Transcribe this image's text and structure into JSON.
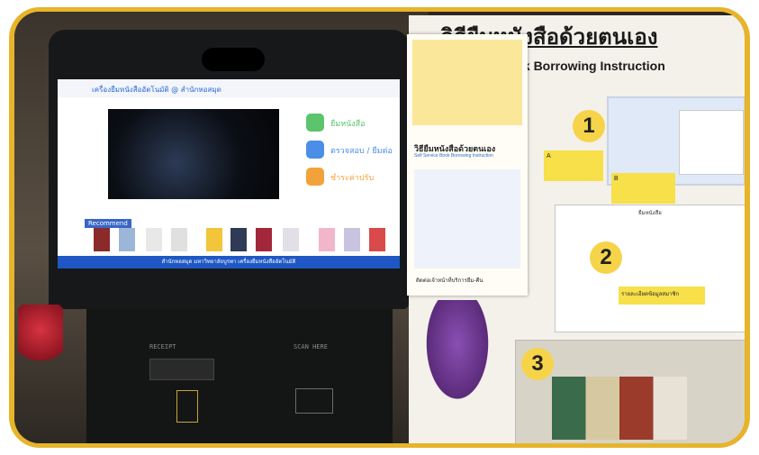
{
  "board": {
    "title": "วิธียืมหนังสือด้วยตนเอง",
    "subtitle": "e Book Borrowing Instruction",
    "steps": [
      "1",
      "2",
      "3"
    ],
    "note_a": "A",
    "note_b": "B",
    "screen2_caption": "รายละเอียดข้อมูลสมาชิก",
    "screen2_title": "ยืมหนังสือ"
  },
  "flyer": {
    "title": "วิธียืมหนังสือด้วยตนเอง",
    "subtitle": "Self Service Book Borrowing Instruction",
    "footer": "ติดต่อเจ้าหน้าที่บริการยืม-คืน"
  },
  "kiosk": {
    "screen_title": "เครื่องยืมหนังสืออัตโนมัติ @ สำนักหอสมุด",
    "menu": [
      {
        "label": "ยืมหนังสือ",
        "color": "#5bc46c"
      },
      {
        "label": "ตรวจสอบ / ยืมต่อ",
        "color": "#4a8ee8"
      },
      {
        "label": "ชำระค่าปรับ",
        "color": "#f2a23a"
      }
    ],
    "recommend_label": "Recommend",
    "footer": "สำนักหอสมุด มหาวิทยาลัยบูรพา เครื่องยืมหนังสืออัตโนมัติ",
    "slot_receipt": "RECEIPT",
    "slot_right": "SCAN HERE"
  },
  "colors": {
    "frame": "#e7b42a",
    "accent_blue": "#1f58c5",
    "highlight_yellow": "#f7e04a"
  }
}
